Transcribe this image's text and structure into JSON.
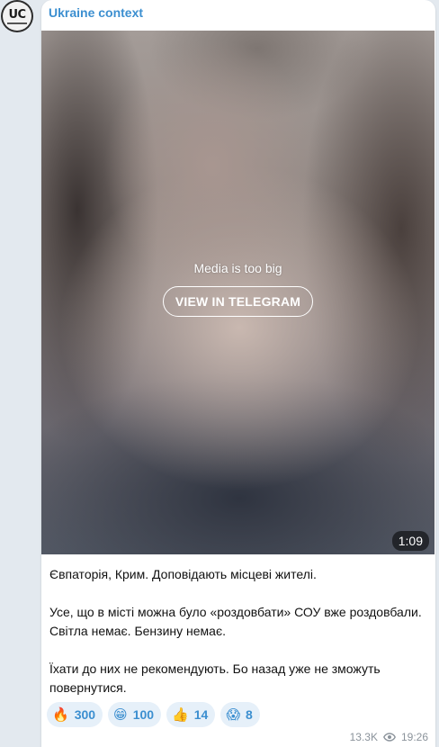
{
  "channel": {
    "name": "Ukraine context",
    "avatar_text": "UC"
  },
  "media": {
    "message": "Media is too big",
    "button_label": "VIEW IN TELEGRAM",
    "duration": "1:09"
  },
  "post": {
    "paragraphs": [
      "Євпаторія, Крим. Доповідають місцеві жителі.",
      "",
      "Усе, що в місті можна було «роздовбати» СОУ вже роздовбали. Світла немає. Бензину немає.",
      "",
      "Їхати до них не рекомендують. Бо назад уже не зможуть повернутися."
    ]
  },
  "reactions": [
    {
      "emoji": "🔥",
      "icon": "fire-icon",
      "count": "300"
    },
    {
      "emoji": "😁",
      "icon": "grin-icon",
      "count": "100"
    },
    {
      "emoji": "👍",
      "icon": "thumbs-up-icon",
      "count": "14"
    },
    {
      "emoji": "😱",
      "icon": "scream-icon",
      "count": "8"
    }
  ],
  "meta": {
    "views": "13.3K",
    "time": "19:26"
  },
  "colors": {
    "accent": "#3c8fd0",
    "background": "#e3e9ef",
    "reaction_bg": "#e6f0f9"
  }
}
